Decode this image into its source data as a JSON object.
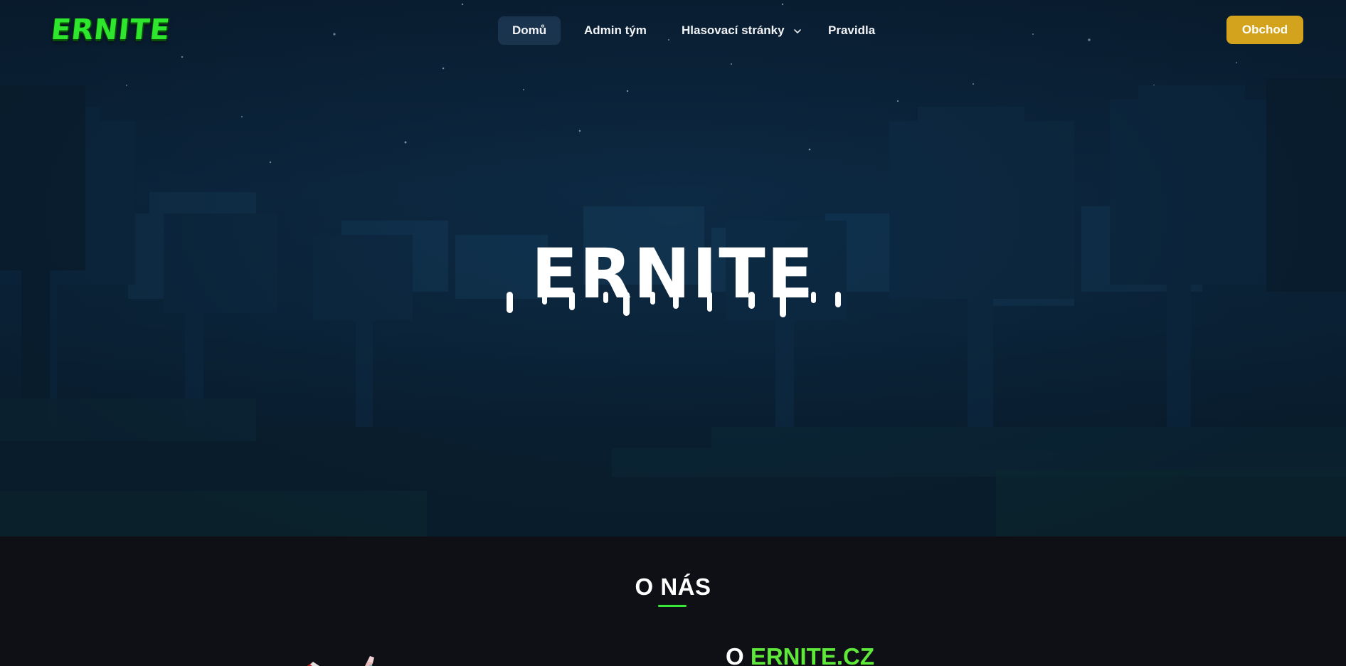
{
  "brand": {
    "logo_text": "ERNITE",
    "hero_title": "ERNITE"
  },
  "nav": {
    "items": [
      {
        "label": "Domů",
        "active": true
      },
      {
        "label": "Admin tým"
      },
      {
        "label": "Hlasovací stránky",
        "has_dropdown": true
      },
      {
        "label": "Pravidla"
      }
    ],
    "shop_label": "Obchod"
  },
  "about": {
    "heading": "O NÁS",
    "subheading_prefix": "O ",
    "subheading_accent": "ERNITE.CZ"
  },
  "colors": {
    "accent_green": "#39e639",
    "shop_button": "#d3a31e",
    "hero_bg": "#0c2840",
    "section_bg": "#0f1015"
  },
  "icons": {
    "dropdown": "chevron-down-icon"
  }
}
